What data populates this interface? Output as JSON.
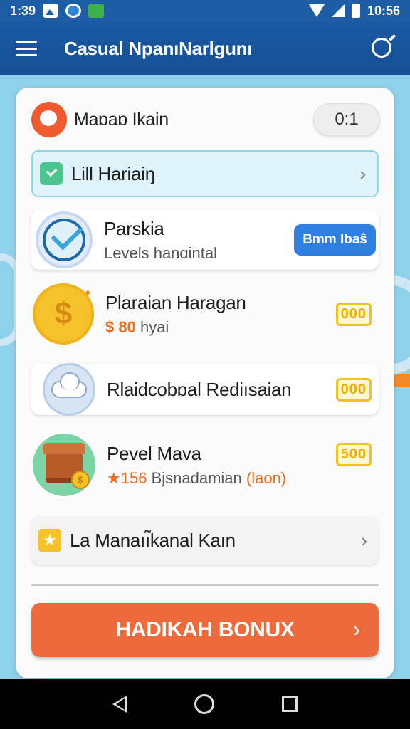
{
  "status_bar": {
    "time_left": "1:39",
    "time_right": "10:56"
  },
  "app_bar": {
    "title": "Casual NpanıNarlgunı",
    "menu_icon": "hamburger-menu-icon",
    "search_icon": "search-icon"
  },
  "header": {
    "title": "Maɒaɒ Ikain",
    "counter": "0:1",
    "icon": "chat-bubble-icon"
  },
  "highlight_row": {
    "title": "Lill Hariaiŋ",
    "icon": "check-square-icon"
  },
  "items": [
    {
      "title": "Parskia",
      "subtitle": "Levels hanɑintal",
      "button": "Bmm Ibaŝ",
      "icon": "checkmark-circle-icon"
    },
    {
      "title": "Plaraian Haragan",
      "price": "$ 80",
      "subtitle": "hyai",
      "badge": "000",
      "icon": "dollar-coin-icon"
    },
    {
      "title": "Rlaidcobɒal Rediısaian",
      "badge": "000",
      "icon": "cloud-icon"
    },
    {
      "title": "Pevel Mava",
      "star_prefix": "★1",
      "star_count": "56",
      "subtitle": "Bjsnadamian",
      "subtitle_suffix": "(laon)",
      "badge": "500",
      "icon": "treasure-chest-icon"
    }
  ],
  "bottom_row": {
    "title": "La Manaıı̃kanal Kaın",
    "icon": "star-square-icon"
  },
  "bonus_button": {
    "label": "HADIKAH BONUX",
    "arrow": "›"
  },
  "colors": {
    "app_bar": "#1a5aa4",
    "accent_orange": "#ee6a3a",
    "button_blue": "#2f7fe0",
    "badge_yellow": "#f4c21f"
  }
}
